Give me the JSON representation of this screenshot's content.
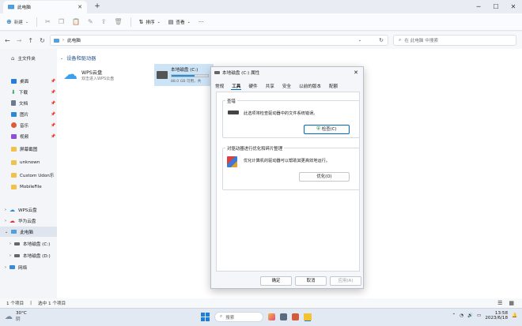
{
  "window": {
    "tab_title": "此电脑",
    "new_tab": "+"
  },
  "toolbar": {
    "new_label": "新建",
    "sort_label": "排序",
    "view_label": "查看",
    "more": "···"
  },
  "address": {
    "path": "此电脑",
    "search_placeholder": "在 此电脑 中搜索"
  },
  "sidebar": {
    "home": "主文件夹",
    "pinned": [
      {
        "label": "桌面",
        "icon": "desktop-icon",
        "color": "#2b7bd8"
      },
      {
        "label": "下载",
        "icon": "download-icon",
        "color": "#2fa360"
      },
      {
        "label": "文档",
        "icon": "document-icon",
        "color": "#6b7a90"
      },
      {
        "label": "图片",
        "icon": "picture-icon",
        "color": "#2b8ad8"
      },
      {
        "label": "音乐",
        "icon": "music-icon",
        "color": "#e05a3a"
      },
      {
        "label": "视频",
        "icon": "video-icon",
        "color": "#8b4fd8"
      }
    ],
    "folders": [
      "屏幕截图",
      "unknown",
      "Custom Udon乐",
      "MobileFile"
    ],
    "clouds": [
      "WPS云盘",
      "华为云盘"
    ],
    "this_pc": "此电脑",
    "drives": [
      "本地磁盘 (C:)",
      "本地磁盘 (D:)"
    ],
    "network": "网络"
  },
  "content": {
    "section_title": "设备和驱动器",
    "wps_title": "WPS云盘",
    "wps_subtitle": "双击进入WPS云盘",
    "drive_c_name": "本地磁盘 (C:)",
    "drive_c_free": "88.0 GB 可用，共",
    "drive_c_fill": 0.62
  },
  "status": {
    "items": "1 个项目",
    "selected": "选中 1 个项目"
  },
  "dialog": {
    "title": "本地磁盘 (C:) 属性",
    "tabs": [
      "常规",
      "工具",
      "硬件",
      "共享",
      "安全",
      "以前的版本",
      "配额"
    ],
    "active_tab": "工具",
    "check_group": "查错",
    "check_desc": "此选项将检查驱动器中的文件系统错误。",
    "check_button": "检查(C)",
    "optimize_group": "对驱动器进行优化和碎片整理",
    "optimize_desc": "优化计算机的驱动器可以帮助其更高效地运行。",
    "optimize_button": "优化(O)",
    "ok": "确定",
    "cancel": "取消",
    "apply": "应用(A)"
  },
  "taskbar": {
    "weather_temp": "30°C",
    "weather_desc": "阴",
    "search": "搜索",
    "time": "13:58",
    "date": "2023/6/18"
  }
}
